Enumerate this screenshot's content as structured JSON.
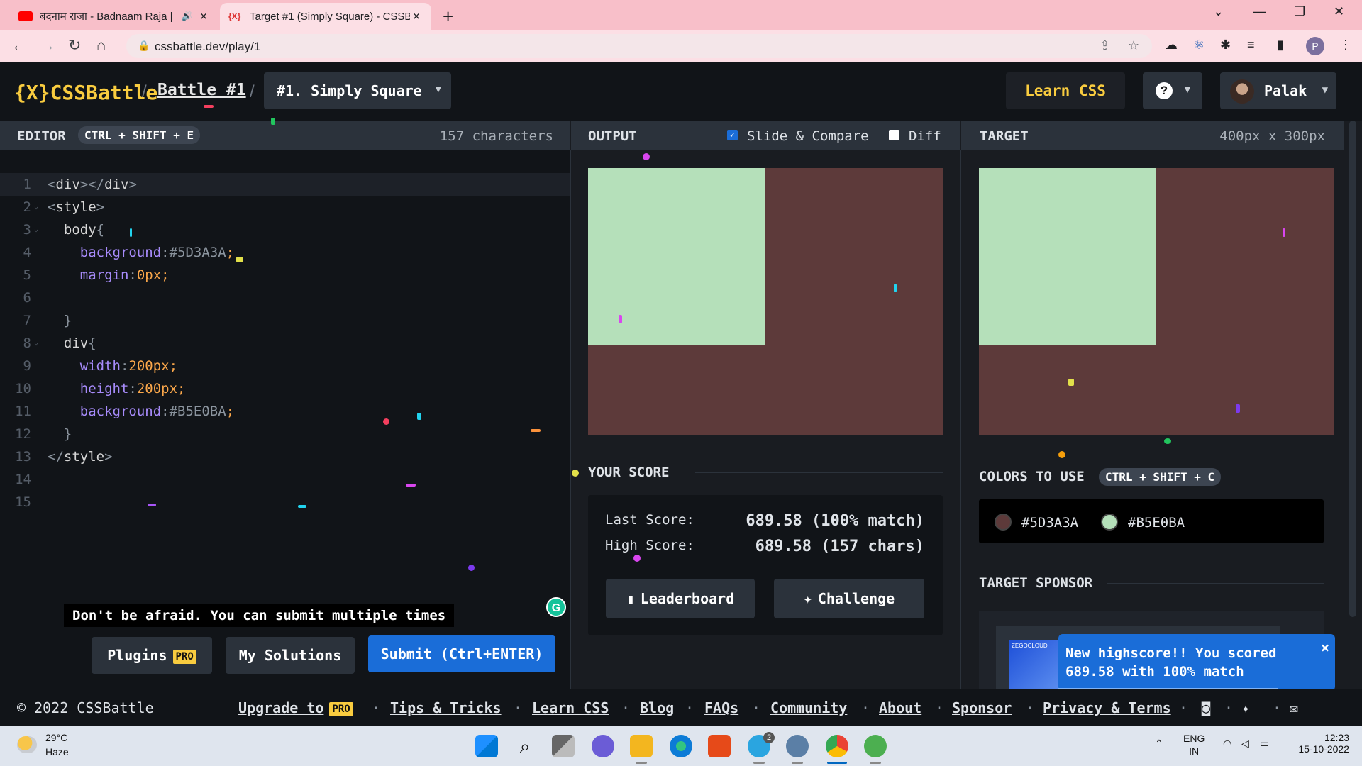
{
  "browser": {
    "tabs": [
      {
        "title": "बदनाम राजा - Badnaam Raja |",
        "favicon": "youtube-icon",
        "audio": "🔊"
      },
      {
        "title": "Target #1 (Simply Square) - CSSB",
        "favicon": "cssbattle-icon"
      }
    ],
    "url": "cssbattle.dev/play/1",
    "profile_initial": "P"
  },
  "header": {
    "logo_text": "{X}CSSBattle",
    "sep1": "/",
    "battle_link": "Battle #1",
    "sep2": "/",
    "target_select": "#1. Simply Square",
    "learn_css": "Learn CSS",
    "help": "?",
    "user_name": "Palak"
  },
  "editor": {
    "label": "EDITOR",
    "shortcut": "CTRL + SHIFT + E",
    "char_count": "157 characters",
    "lines": [
      "1",
      "2",
      "3",
      "4",
      "5",
      "6",
      "7",
      "8",
      "9",
      "10",
      "11",
      "12",
      "13",
      "14",
      "15"
    ],
    "tip": "Don't be afraid. You can submit multiple times",
    "plugins_label": "Plugins",
    "pro_badge": "PRO",
    "solutions_label": "My Solutions",
    "submit_label": "Submit (Ctrl+ENTER)"
  },
  "output": {
    "label": "OUTPUT",
    "slide_compare": "Slide & Compare",
    "slide_compare_checked": true,
    "diff": "Diff",
    "diff_checked": false,
    "score_title": "YOUR SCORE",
    "last_score_label": "Last Score:",
    "last_score_value": "689.58 (100% match)",
    "high_score_label": "High Score:",
    "high_score_value": "689.58 (157 chars)",
    "leaderboard_label": "Leaderboard",
    "challenge_label": "Challenge"
  },
  "target": {
    "label": "TARGET",
    "size": "400px x 300px",
    "colors_title": "COLORS TO USE",
    "colors_shortcut": "CTRL + SHIFT + C",
    "colors": [
      {
        "hex": "#5D3A3A"
      },
      {
        "hex": "#B5E0BA"
      }
    ],
    "sponsor_title": "TARGET SPONSOR",
    "sponsor_logo": "ZEGOCLOUD"
  },
  "toast": {
    "line1": "New highscore!! You scored",
    "line2": "689.58 with 100% match",
    "close": "×"
  },
  "footer": {
    "copyright": "© 2022 CSSBattle",
    "upgrade": "Upgrade to",
    "pro": "PRO",
    "links": [
      "Tips & Tricks",
      "Learn CSS",
      "Blog",
      "FAQs",
      "Community",
      "About",
      "Sponsor",
      "Privacy & Terms"
    ]
  },
  "taskbar": {
    "temp": "29°C",
    "weather": "Haze",
    "lang1": "ENG",
    "lang2": "IN",
    "time": "12:23",
    "date": "15-10-2022",
    "telegram_badge": "2"
  },
  "colors": {
    "accent": "#f9cc3f",
    "panel": "#2b323b",
    "bg": "#111418",
    "submit": "#1a6dd8"
  }
}
